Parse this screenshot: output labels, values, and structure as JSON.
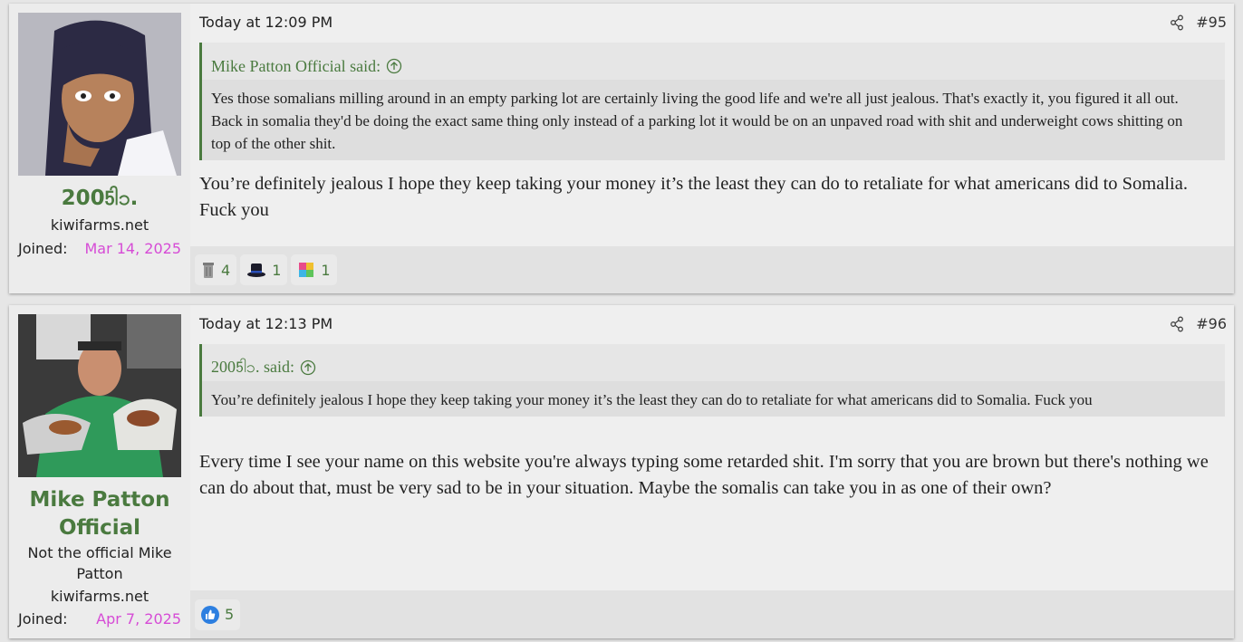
{
  "posts": [
    {
      "username": "2005ါ၁.",
      "user_title": "",
      "site": "kiwifarms.net",
      "joined_label": "Joined:",
      "joined_date": "Mar 14, 2025",
      "timestamp": "Today at 12:09 PM",
      "post_number": "#95",
      "quote": {
        "author_said": "Mike Patton Official said:",
        "text": "Yes those somalians milling around in an empty parking lot are certainly living the good life and we're all just jealous. That's exactly it, you figured it all out. Back in somalia they'd be doing the exact same thing only instead of a parking lot it would be on an unpaved road with shit and underweight cows shitting on top of the other shit."
      },
      "message": "You’re definitely jealous I hope they keep taking your money it’s the least they can do to retaliate for what americans did to Somalia. Fuck you",
      "reactions": [
        {
          "icon": "trash-can-icon",
          "count": "4"
        },
        {
          "icon": "top-hat-icon",
          "count": "1"
        },
        {
          "icon": "puzzle-piece-icon",
          "count": "1"
        }
      ]
    },
    {
      "username": "Mike Patton Official",
      "user_title": "Not the official Mike Patton",
      "site": "kiwifarms.net",
      "joined_label": "Joined:",
      "joined_date": "Apr 7, 2025",
      "timestamp": "Today at 12:13 PM",
      "post_number": "#96",
      "quote": {
        "author_said": "2005ါ၁. said:",
        "text": "You’re definitely jealous I hope they keep taking your money it’s the least they can do to retaliate for what americans did to Somalia. Fuck you"
      },
      "message": "Every time I see your name on this website you're always typing some retarded shit. I'm sorry that you are brown but there's nothing we can do about that, must be very sad to be in your situation. Maybe the somalis can take you in as one of their own?",
      "reactions": [
        {
          "icon": "thumbs-up-icon",
          "count": "5"
        }
      ]
    }
  ],
  "colors": {
    "username": "#4a7a3f",
    "joined_date": "#d64bd6",
    "quote_border": "#4a7a3f"
  }
}
